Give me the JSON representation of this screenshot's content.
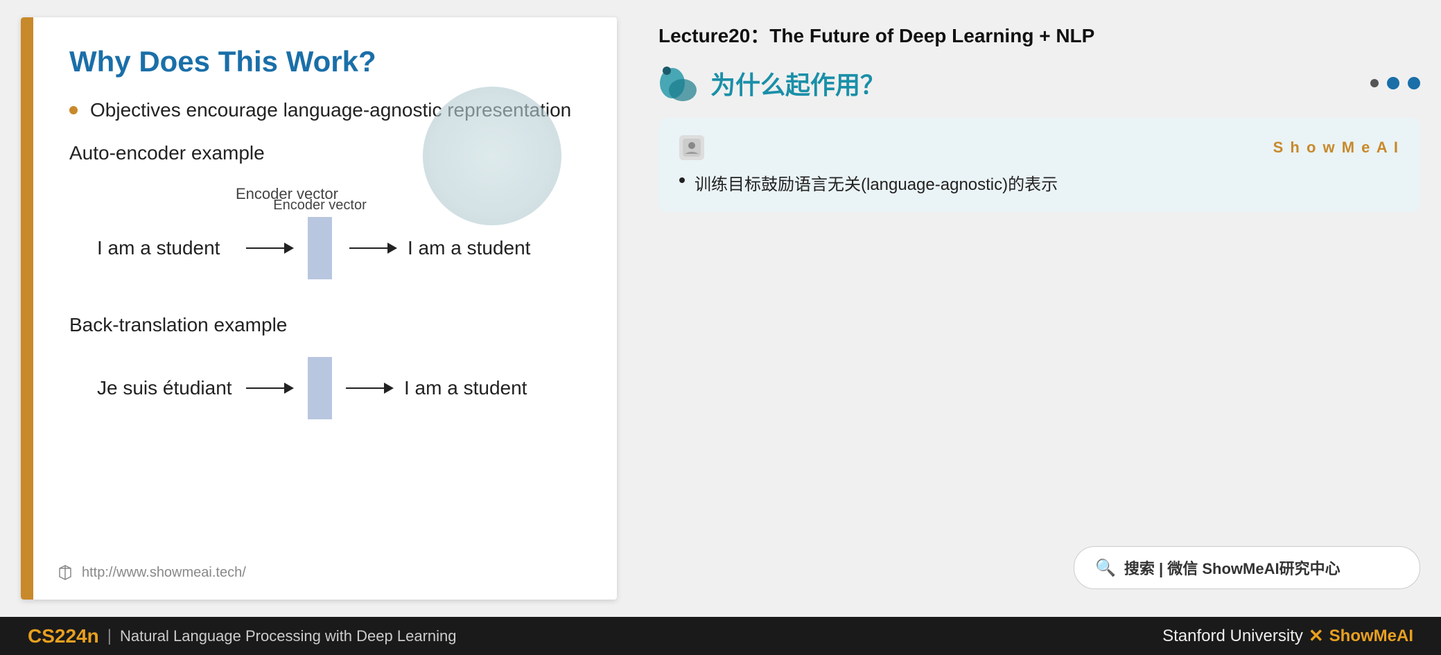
{
  "slide": {
    "title": "Why Does This Work?",
    "bullet1": "Objectives encourage language-agnostic representation",
    "autoencoder_label": "Auto-encoder example",
    "encoder_vector_label": "Encoder vector",
    "ae_input": "I am a student",
    "ae_output": "I am a student",
    "backtrans_label": "Back-translation example",
    "bt_input": "Je suis étudiant",
    "bt_output": "I am a student",
    "url": "http://www.showmeai.tech/"
  },
  "right_panel": {
    "lecture_title": "Lecture20：The Future of Deep Learning + NLP",
    "chinese_title": "为什么起作用？",
    "showmeai_brand": "S h o w M e A I",
    "chinese_bullet": "训练目标鼓励语言无关(language-agnostic)的表示"
  },
  "bottom_bar": {
    "course_code": "CS224n",
    "pipe": "|",
    "course_name": "Natural Language Processing with Deep Learning",
    "university": "Stanford University",
    "x_mark": "✕",
    "showmeai": "ShowMeAI"
  },
  "search": {
    "icon": "🔍",
    "text": "搜索 | 微信 ShowMeAI研究中心"
  }
}
